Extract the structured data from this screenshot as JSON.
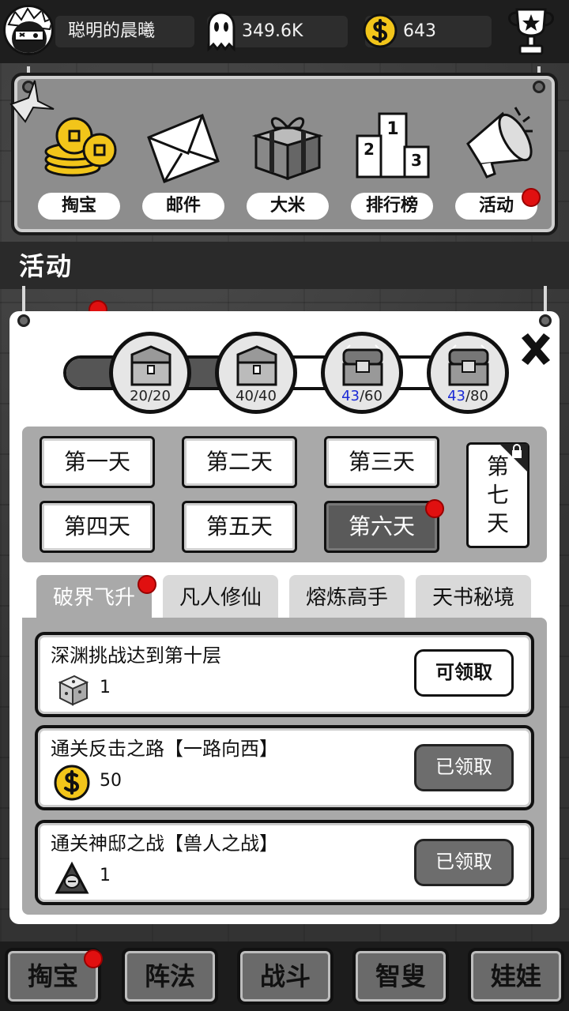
{
  "header": {
    "player_name": "聪明的晨曦",
    "ghost_amount": "349.6K",
    "coin_amount": "643"
  },
  "menu": {
    "items": [
      {
        "label": "掏宝",
        "icon": "coins-icon"
      },
      {
        "label": "邮件",
        "icon": "mail-icon"
      },
      {
        "label": "大米",
        "icon": "gift-box-icon"
      },
      {
        "label": "排行榜",
        "icon": "podium-icon"
      },
      {
        "label": "活动",
        "icon": "megaphone-icon"
      }
    ],
    "podium_numbers": [
      "1",
      "2",
      "3"
    ]
  },
  "section_title": "活动",
  "chests": [
    {
      "current": "20",
      "target": "/20",
      "opened": true
    },
    {
      "current": "40",
      "target": "/40",
      "opened": true
    },
    {
      "current": "43",
      "target": "/60",
      "opened": false
    },
    {
      "current": "43",
      "target": "/80",
      "opened": false
    }
  ],
  "progress_fraction": 0.5,
  "days": {
    "d1": "第一天",
    "d2": "第二天",
    "d3": "第三天",
    "d4": "第四天",
    "d5": "第五天",
    "d6": "第六天",
    "d7_line1": "第",
    "d7_line2": "七",
    "d7_line3": "天",
    "selected": "第六天"
  },
  "tabs": {
    "t1": "破界飞升",
    "t2": "凡人修仙",
    "t3": "熔炼高手",
    "t4": "天书秘境"
  },
  "tasks": [
    {
      "title": "深渊挑战达到第十层",
      "reward_icon": "dice-icon",
      "qty": "1",
      "button": "可领取",
      "state": "claimable"
    },
    {
      "title": "通关反击之路【一路向西】",
      "reward_icon": "coin-icon",
      "qty": "50",
      "button": "已领取",
      "state": "claimed"
    },
    {
      "title": "通关神邸之战【兽人之战】",
      "reward_icon": "hooded-figure-icon",
      "qty": "1",
      "button": "已领取",
      "state": "claimed"
    }
  ],
  "bottom_nav": {
    "b1": "掏宝",
    "b2": "阵法",
    "b3": "战斗",
    "b4": "智叟",
    "b5": "娃娃"
  },
  "colors": {
    "notification_dot": "#e01010",
    "progress_blue": "#1c2bd6",
    "coin_gold": "#f2c51a"
  }
}
